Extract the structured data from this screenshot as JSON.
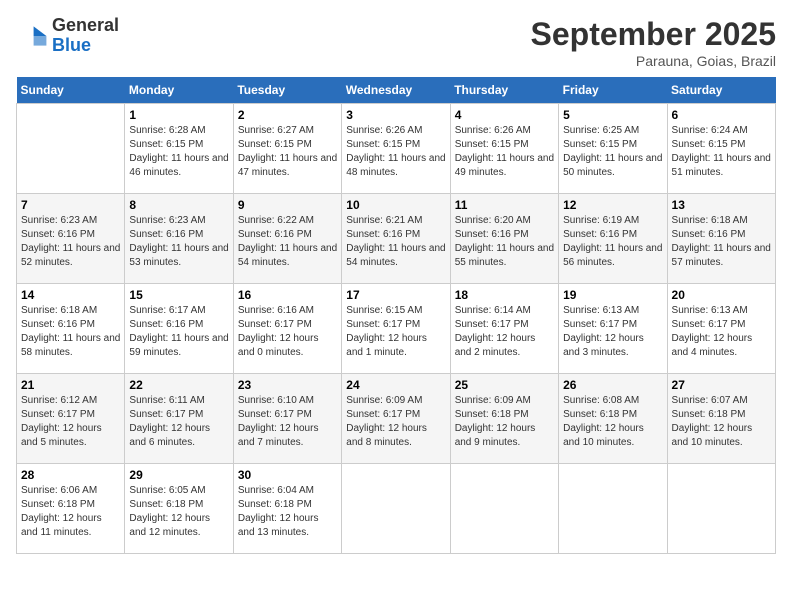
{
  "logo": {
    "general": "General",
    "blue": "Blue"
  },
  "title": "September 2025",
  "location": "Parauna, Goias, Brazil",
  "days_of_week": [
    "Sunday",
    "Monday",
    "Tuesday",
    "Wednesday",
    "Thursday",
    "Friday",
    "Saturday"
  ],
  "weeks": [
    [
      {
        "day": "",
        "sunrise": "",
        "sunset": "",
        "daylight": ""
      },
      {
        "day": "1",
        "sunrise": "Sunrise: 6:28 AM",
        "sunset": "Sunset: 6:15 PM",
        "daylight": "Daylight: 11 hours and 46 minutes."
      },
      {
        "day": "2",
        "sunrise": "Sunrise: 6:27 AM",
        "sunset": "Sunset: 6:15 PM",
        "daylight": "Daylight: 11 hours and 47 minutes."
      },
      {
        "day": "3",
        "sunrise": "Sunrise: 6:26 AM",
        "sunset": "Sunset: 6:15 PM",
        "daylight": "Daylight: 11 hours and 48 minutes."
      },
      {
        "day": "4",
        "sunrise": "Sunrise: 6:26 AM",
        "sunset": "Sunset: 6:15 PM",
        "daylight": "Daylight: 11 hours and 49 minutes."
      },
      {
        "day": "5",
        "sunrise": "Sunrise: 6:25 AM",
        "sunset": "Sunset: 6:15 PM",
        "daylight": "Daylight: 11 hours and 50 minutes."
      },
      {
        "day": "6",
        "sunrise": "Sunrise: 6:24 AM",
        "sunset": "Sunset: 6:15 PM",
        "daylight": "Daylight: 11 hours and 51 minutes."
      }
    ],
    [
      {
        "day": "7",
        "sunrise": "Sunrise: 6:23 AM",
        "sunset": "Sunset: 6:16 PM",
        "daylight": "Daylight: 11 hours and 52 minutes."
      },
      {
        "day": "8",
        "sunrise": "Sunrise: 6:23 AM",
        "sunset": "Sunset: 6:16 PM",
        "daylight": "Daylight: 11 hours and 53 minutes."
      },
      {
        "day": "9",
        "sunrise": "Sunrise: 6:22 AM",
        "sunset": "Sunset: 6:16 PM",
        "daylight": "Daylight: 11 hours and 54 minutes."
      },
      {
        "day": "10",
        "sunrise": "Sunrise: 6:21 AM",
        "sunset": "Sunset: 6:16 PM",
        "daylight": "Daylight: 11 hours and 54 minutes."
      },
      {
        "day": "11",
        "sunrise": "Sunrise: 6:20 AM",
        "sunset": "Sunset: 6:16 PM",
        "daylight": "Daylight: 11 hours and 55 minutes."
      },
      {
        "day": "12",
        "sunrise": "Sunrise: 6:19 AM",
        "sunset": "Sunset: 6:16 PM",
        "daylight": "Daylight: 11 hours and 56 minutes."
      },
      {
        "day": "13",
        "sunrise": "Sunrise: 6:18 AM",
        "sunset": "Sunset: 6:16 PM",
        "daylight": "Daylight: 11 hours and 57 minutes."
      }
    ],
    [
      {
        "day": "14",
        "sunrise": "Sunrise: 6:18 AM",
        "sunset": "Sunset: 6:16 PM",
        "daylight": "Daylight: 11 hours and 58 minutes."
      },
      {
        "day": "15",
        "sunrise": "Sunrise: 6:17 AM",
        "sunset": "Sunset: 6:16 PM",
        "daylight": "Daylight: 11 hours and 59 minutes."
      },
      {
        "day": "16",
        "sunrise": "Sunrise: 6:16 AM",
        "sunset": "Sunset: 6:17 PM",
        "daylight": "Daylight: 12 hours and 0 minutes."
      },
      {
        "day": "17",
        "sunrise": "Sunrise: 6:15 AM",
        "sunset": "Sunset: 6:17 PM",
        "daylight": "Daylight: 12 hours and 1 minute."
      },
      {
        "day": "18",
        "sunrise": "Sunrise: 6:14 AM",
        "sunset": "Sunset: 6:17 PM",
        "daylight": "Daylight: 12 hours and 2 minutes."
      },
      {
        "day": "19",
        "sunrise": "Sunrise: 6:13 AM",
        "sunset": "Sunset: 6:17 PM",
        "daylight": "Daylight: 12 hours and 3 minutes."
      },
      {
        "day": "20",
        "sunrise": "Sunrise: 6:13 AM",
        "sunset": "Sunset: 6:17 PM",
        "daylight": "Daylight: 12 hours and 4 minutes."
      }
    ],
    [
      {
        "day": "21",
        "sunrise": "Sunrise: 6:12 AM",
        "sunset": "Sunset: 6:17 PM",
        "daylight": "Daylight: 12 hours and 5 minutes."
      },
      {
        "day": "22",
        "sunrise": "Sunrise: 6:11 AM",
        "sunset": "Sunset: 6:17 PM",
        "daylight": "Daylight: 12 hours and 6 minutes."
      },
      {
        "day": "23",
        "sunrise": "Sunrise: 6:10 AM",
        "sunset": "Sunset: 6:17 PM",
        "daylight": "Daylight: 12 hours and 7 minutes."
      },
      {
        "day": "24",
        "sunrise": "Sunrise: 6:09 AM",
        "sunset": "Sunset: 6:17 PM",
        "daylight": "Daylight: 12 hours and 8 minutes."
      },
      {
        "day": "25",
        "sunrise": "Sunrise: 6:09 AM",
        "sunset": "Sunset: 6:18 PM",
        "daylight": "Daylight: 12 hours and 9 minutes."
      },
      {
        "day": "26",
        "sunrise": "Sunrise: 6:08 AM",
        "sunset": "Sunset: 6:18 PM",
        "daylight": "Daylight: 12 hours and 10 minutes."
      },
      {
        "day": "27",
        "sunrise": "Sunrise: 6:07 AM",
        "sunset": "Sunset: 6:18 PM",
        "daylight": "Daylight: 12 hours and 10 minutes."
      }
    ],
    [
      {
        "day": "28",
        "sunrise": "Sunrise: 6:06 AM",
        "sunset": "Sunset: 6:18 PM",
        "daylight": "Daylight: 12 hours and 11 minutes."
      },
      {
        "day": "29",
        "sunrise": "Sunrise: 6:05 AM",
        "sunset": "Sunset: 6:18 PM",
        "daylight": "Daylight: 12 hours and 12 minutes."
      },
      {
        "day": "30",
        "sunrise": "Sunrise: 6:04 AM",
        "sunset": "Sunset: 6:18 PM",
        "daylight": "Daylight: 12 hours and 13 minutes."
      },
      {
        "day": "",
        "sunrise": "",
        "sunset": "",
        "daylight": ""
      },
      {
        "day": "",
        "sunrise": "",
        "sunset": "",
        "daylight": ""
      },
      {
        "day": "",
        "sunrise": "",
        "sunset": "",
        "daylight": ""
      },
      {
        "day": "",
        "sunrise": "",
        "sunset": "",
        "daylight": ""
      }
    ]
  ]
}
